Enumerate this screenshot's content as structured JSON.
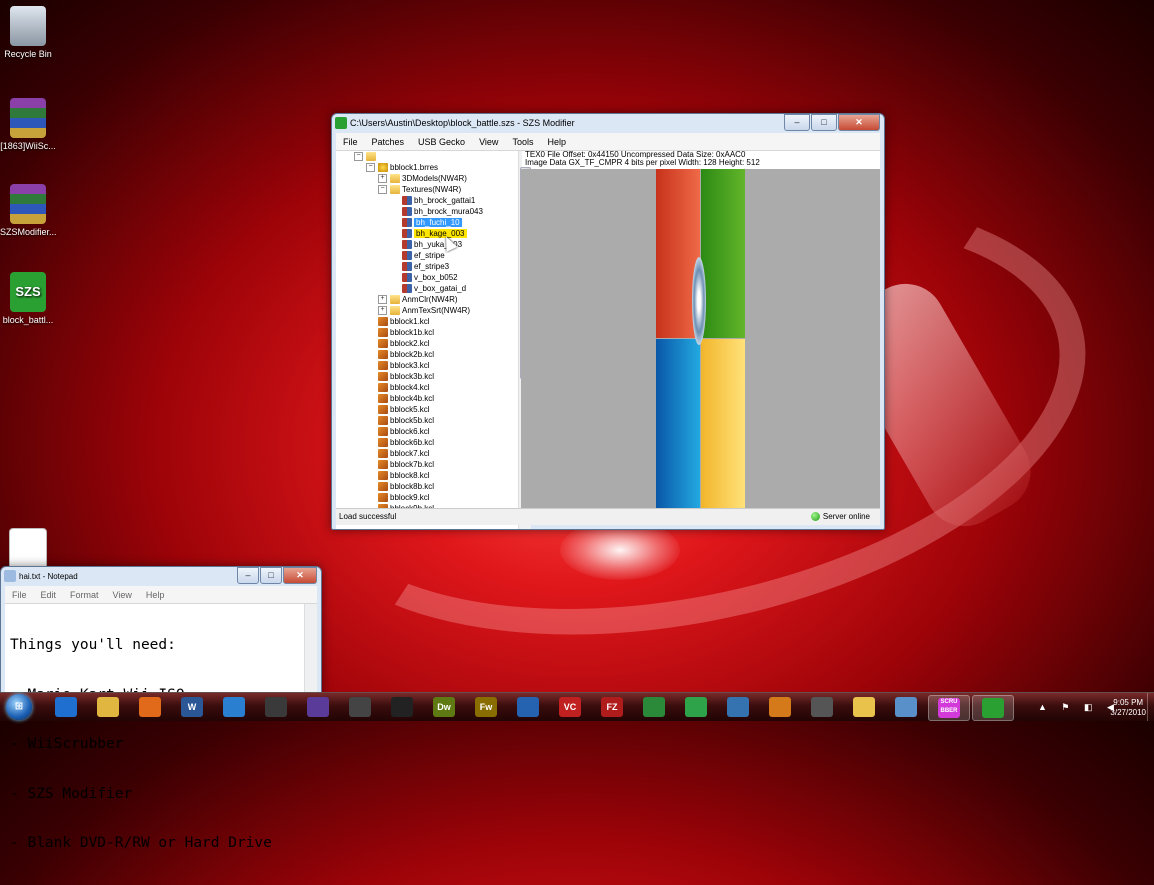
{
  "desktop": {
    "icons": [
      {
        "label": "Recycle Bin"
      },
      {
        "label": "[1863]WiiSc..."
      },
      {
        "label": "SZSModifier..."
      },
      {
        "label": "block_battl..."
      },
      {
        "label": ""
      }
    ]
  },
  "szs": {
    "title": "C:\\Users\\Austin\\Desktop\\block_battle.szs - SZS Modifier",
    "menu": [
      "File",
      "Patches",
      "USB Gecko",
      "View",
      "Tools",
      "Help"
    ],
    "info_line1": "TEX0 File Offset: 0x44150 Uncompressed Data Size: 0xAAC0",
    "info_line2": "Image Data GX_TF_CMPR 4 bits per pixel Width: 128 Height: 512",
    "tree": {
      "brres": "bblock1.brres",
      "models": "3DModels(NW4R)",
      "textures": "Textures(NW4R)",
      "texture_items": [
        "bh_brock_gattai1",
        "bh_brock_mura043",
        "bh_fuchi_10",
        "bh_kage_003",
        "bh_yuka_p03",
        "ef_stripe",
        "ef_stripe3",
        "v_box_b052",
        "v_box_gatai_d"
      ],
      "anm_clr": "AnmClr(NW4R)",
      "anm_tex": "AnmTexSrt(NW4R)",
      "kcl_items": [
        "bblock1.kcl",
        "bblock1b.kcl",
        "bblock2.kcl",
        "bblock2b.kcl",
        "bblock3.kcl",
        "bblock3b.kcl",
        "bblock4.kcl",
        "bblock4b.kcl",
        "bblock5.kcl",
        "bblock5b.kcl",
        "bblock6.kcl",
        "bblock6b.kcl",
        "bblock7.kcl",
        "bblock7b.kcl",
        "bblock8.kcl",
        "bblock8b.kcl",
        "bblock9.kcl",
        "bblock9b.kcl"
      ]
    },
    "status_left": "Load successful",
    "status_right": "Server online"
  },
  "notepad": {
    "title": "hai.txt - Notepad",
    "menu": [
      "File",
      "Edit",
      "Format",
      "View",
      "Help"
    ],
    "lines": [
      "Things you'll need:",
      "- Mario Kart Wii ISO",
      "- WiiScrubber",
      "- SZS Modifier",
      "- Blank DVD-R/RW or Hard Drive"
    ]
  },
  "taskbar": {
    "apps": [
      {
        "icon": "internet-explorer-icon",
        "label": "",
        "color": "#1e6fd0"
      },
      {
        "icon": "explorer-icon",
        "label": "",
        "color": "#e0b640"
      },
      {
        "icon": "media-player-icon",
        "label": "",
        "color": "#e06a1a"
      },
      {
        "icon": "word-icon",
        "label": "W",
        "color": "#2b5797"
      },
      {
        "icon": "refresh-icon",
        "label": "",
        "color": "#2a7fd0"
      },
      {
        "icon": "app-icon",
        "label": "",
        "color": "#3a3a3a"
      },
      {
        "icon": "vs-icon",
        "label": "",
        "color": "#5b3b9a"
      },
      {
        "icon": "camera-icon",
        "label": "",
        "color": "#444"
      },
      {
        "icon": "football-icon",
        "label": "",
        "color": "#222"
      },
      {
        "icon": "dreamweaver-icon",
        "label": "Dw",
        "color": "#5f7a13"
      },
      {
        "icon": "fireworks-icon",
        "label": "Fw",
        "color": "#8a6d00"
      },
      {
        "icon": "network-icon",
        "label": "",
        "color": "#2563b0"
      },
      {
        "icon": "vc-icon",
        "label": "VC",
        "color": "#c02020"
      },
      {
        "icon": "filezilla-icon",
        "label": "FZ",
        "color": "#b01b1b"
      },
      {
        "icon": "globe-icon",
        "label": "",
        "color": "#2a8a3a"
      },
      {
        "icon": "plus-icon",
        "label": "",
        "color": "#2fa34a"
      },
      {
        "icon": "tools-icon",
        "label": "",
        "color": "#3572b0"
      },
      {
        "icon": "pen-icon",
        "label": "",
        "color": "#d47a1a"
      },
      {
        "icon": "wheel-icon",
        "label": "",
        "color": "#555"
      },
      {
        "icon": "folder-icon",
        "label": "",
        "color": "#e8c24a"
      },
      {
        "icon": "notepad-icon",
        "label": "",
        "color": "#5a90c9"
      },
      {
        "icon": "scrubber-icon",
        "label": "SCRU BBER",
        "color": "#d23ad9"
      },
      {
        "icon": "szs-icon",
        "label": "",
        "color": "#2aa032"
      }
    ],
    "time": "9:05 PM",
    "date": "3/27/2010"
  }
}
